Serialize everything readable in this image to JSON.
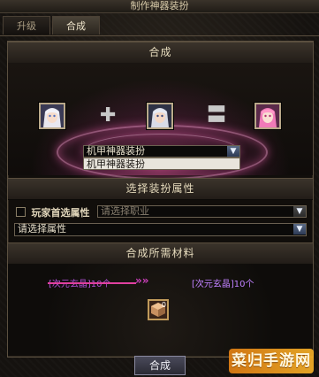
{
  "window": {
    "title": "制作神器装扮"
  },
  "tabs": [
    {
      "label": "升级",
      "active": false
    },
    {
      "label": "合成",
      "active": true
    }
  ],
  "synth": {
    "header": "合成",
    "operator_plus": "✚",
    "operator_equals": "〓",
    "dropdown_value": "机甲神器装扮",
    "dropdown_option": "机甲神器装扮"
  },
  "attributes": {
    "header": "选择装扮属性",
    "preferred_label": "玩家首选属性",
    "job_placeholder": "请选择职业",
    "attr_placeholder": "请选择属性"
  },
  "materials": {
    "header": "合成所需材料",
    "left_item": "[次元玄晶]10个",
    "right_item": "[次元玄晶]10个",
    "arrows": "»»",
    "icon_count": "0"
  },
  "buttons": {
    "synthesize": "合成"
  },
  "watermark": "菜归手游网",
  "colors": {
    "accent_purple": "#b050d8",
    "glow_pink": "#d84ea0"
  }
}
